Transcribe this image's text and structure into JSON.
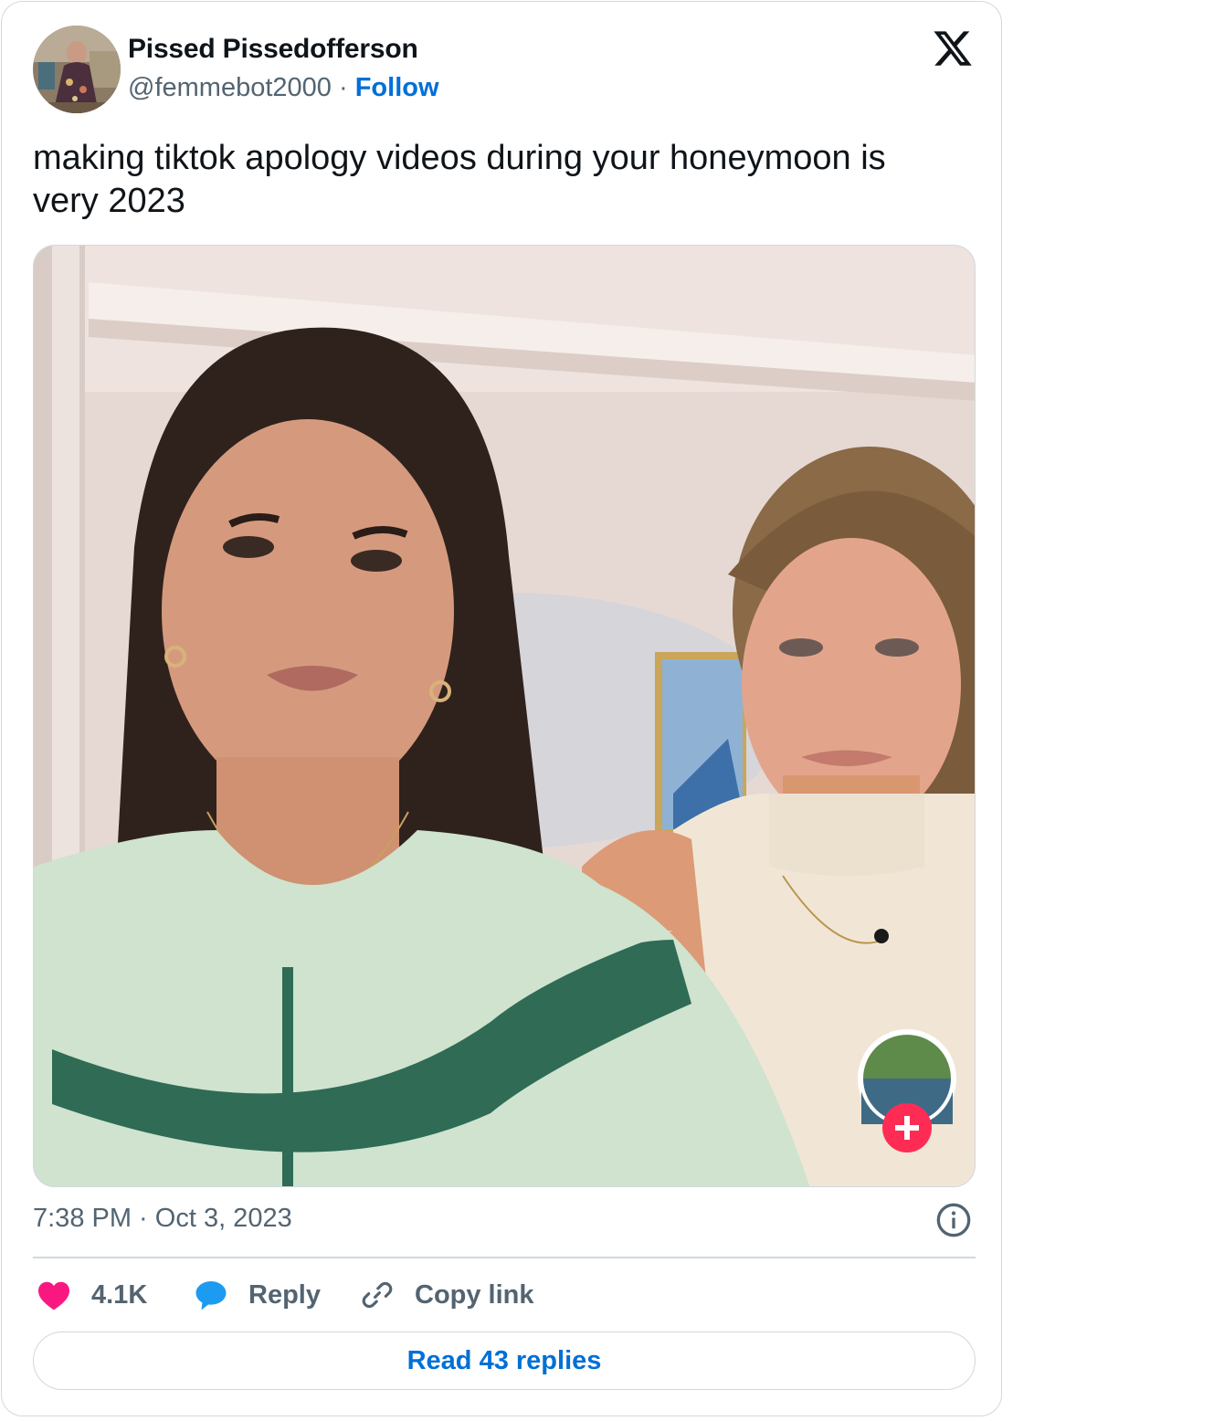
{
  "author": {
    "display_name": "Pissed Pissedofferson",
    "handle": "@femmebot2000",
    "separator": "·",
    "follow_label": "Follow"
  },
  "tweet": {
    "text": "making tiktok apology videos during your honeymoon is very 2023",
    "timestamp": "7:38 PM · Oct 3, 2023"
  },
  "actions": {
    "like_count": "4.1K",
    "reply_label": "Reply",
    "copy_label": "Copy link"
  },
  "read_replies_label": "Read 43 replies",
  "colors": {
    "accent": "#006fd6",
    "like": "#f91880",
    "reply": "#1d9bf0",
    "muted": "#536471",
    "border": "#cfd9de",
    "tiktok_plus": "#fe2c55"
  },
  "icons": {
    "brand": "x-logo-icon",
    "info": "info-icon",
    "like": "heart-icon",
    "reply": "speech-bubble-icon",
    "copy": "link-icon"
  }
}
